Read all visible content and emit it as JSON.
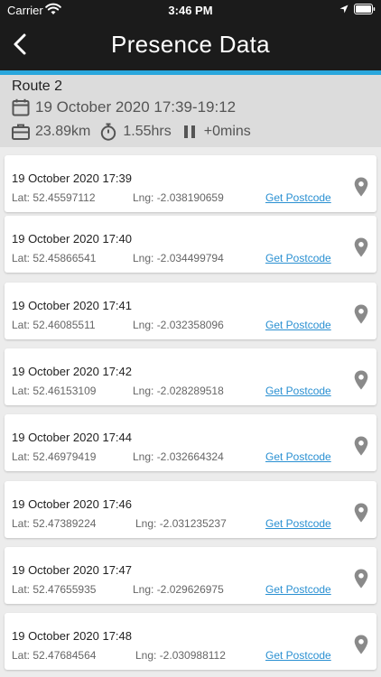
{
  "status_bar": {
    "carrier": "Carrier",
    "time": "3:46 PM"
  },
  "header": {
    "title": "Presence Data"
  },
  "route": {
    "name": "Route 2",
    "date_range": "19 October 2020 17:39-19:12",
    "distance": "23.89km",
    "duration": "1.55hrs",
    "paused": "+0mins"
  },
  "link_label": "Get Postcode",
  "entries": [
    {
      "time": "19 October 2020 17:39",
      "lat": "Lat: 52.45597112",
      "lng": "Lng: -2.038190659"
    },
    {
      "time": "19 October 2020 17:40",
      "lat": "Lat: 52.45866541",
      "lng": "Lng: -2.034499794"
    },
    {
      "time": "19 October 2020 17:41",
      "lat": "Lat: 52.46085511",
      "lng": "Lng: -2.032358096"
    },
    {
      "time": "19 October 2020 17:42",
      "lat": "Lat: 52.46153109",
      "lng": "Lng: -2.028289518"
    },
    {
      "time": "19 October 2020 17:44",
      "lat": "Lat: 52.46979419",
      "lng": "Lng: -2.032664324"
    },
    {
      "time": "19 October 2020 17:46",
      "lat": "Lat: 52.47389224",
      "lng": "Lng: -2.031235237"
    },
    {
      "time": "19 October 2020 17:47",
      "lat": "Lat: 52.47655935",
      "lng": "Lng: -2.029626975"
    },
    {
      "time": "19 October 2020 17:48",
      "lat": "Lat: 52.47684564",
      "lng": "Lng: -2.030988112"
    }
  ],
  "icons": {
    "status": [
      "wifi-icon",
      "location-arrow-icon",
      "battery-icon"
    ],
    "header": [
      "back-chevron-icon"
    ],
    "summary": [
      "calendar-icon",
      "briefcase-icon",
      "stopwatch-icon",
      "pause-icon"
    ],
    "entry": [
      "map-pin-icon"
    ]
  },
  "colors": {
    "header_bg": "#1b1b1b",
    "accent": "#29a6dc",
    "summary_bg": "#dcdcdc",
    "link": "#2a90d2",
    "pin": "#8a8a8a"
  }
}
